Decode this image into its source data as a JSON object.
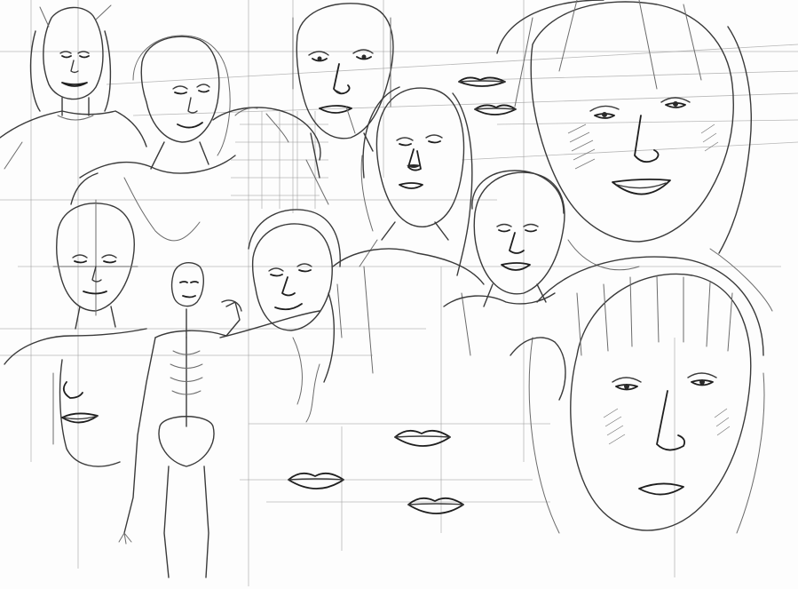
{
  "image": {
    "kind": "pencil sketch study sheet",
    "palette": {
      "paper": "#fdfdfd",
      "graphite": "#3a3a3a",
      "guide": "#9a9a9a"
    }
  },
  "elements": {
    "figures": [
      "small-portrait-top-left",
      "woman-long-hair-top",
      "face-grid-center-top",
      "woman-center-long-hair",
      "smiling-woman-right-large",
      "man-short-hair-center-right",
      "woman-with-fringe-bottom-right",
      "bald-face-left",
      "skeleton-figure",
      "woman-center-smiling",
      "partial-face-left"
    ],
    "lip_studies": 6
  }
}
